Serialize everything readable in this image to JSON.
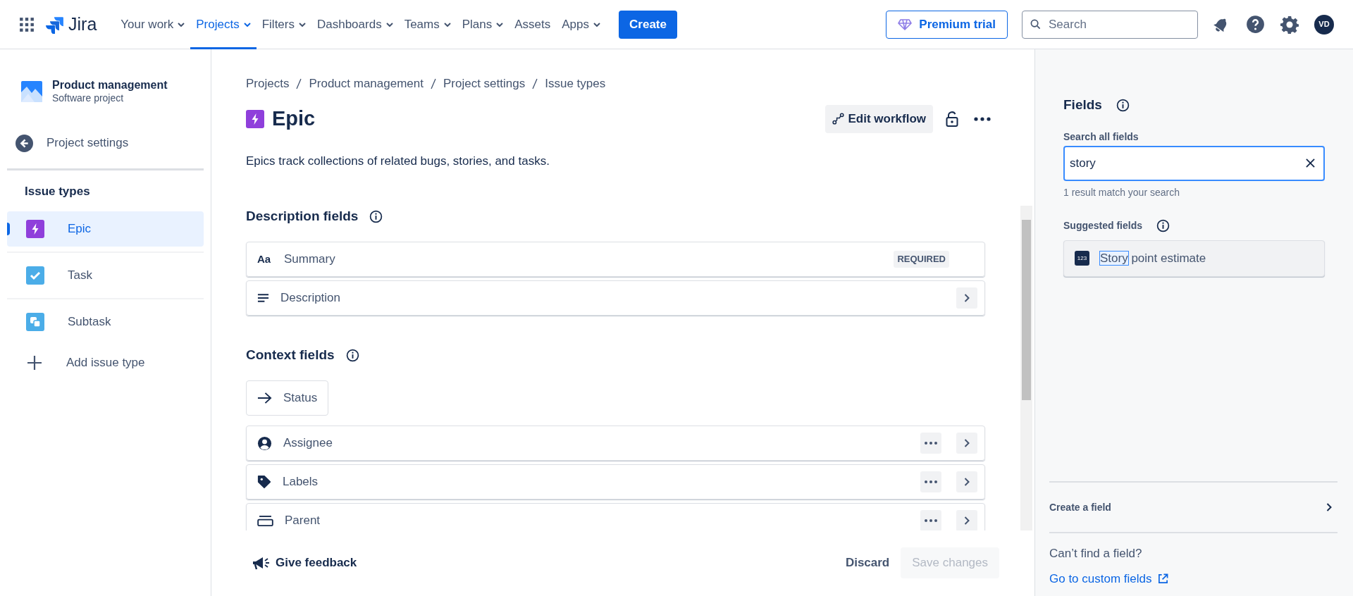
{
  "nav": {
    "logo": "Jira",
    "items": [
      {
        "label": "Your work",
        "dropdown": true,
        "selected": false
      },
      {
        "label": "Projects",
        "dropdown": true,
        "selected": true
      },
      {
        "label": "Filters",
        "dropdown": true,
        "selected": false
      },
      {
        "label": "Dashboards",
        "dropdown": true,
        "selected": false
      },
      {
        "label": "Teams",
        "dropdown": true,
        "selected": false
      },
      {
        "label": "Plans",
        "dropdown": true,
        "selected": false
      },
      {
        "label": "Assets",
        "dropdown": false,
        "selected": false
      },
      {
        "label": "Apps",
        "dropdown": true,
        "selected": false
      }
    ],
    "create": "Create",
    "premium": "Premium trial",
    "search_placeholder": "Search",
    "avatar": "VD"
  },
  "sidebar": {
    "project": "Product management",
    "project_type": "Software project",
    "back": "Project settings",
    "section": "Issue types",
    "items": [
      {
        "label": "Epic",
        "kind": "epic",
        "selected": true
      },
      {
        "label": "Task",
        "kind": "task",
        "selected": false
      },
      {
        "label": "Subtask",
        "kind": "subtask",
        "selected": false
      }
    ],
    "add": "Add issue type"
  },
  "main": {
    "breadcrumbs": [
      "Projects",
      "Product management",
      "Project settings",
      "Issue types"
    ],
    "title": "Epic",
    "edit_workflow": "Edit workflow",
    "description": "Epics track collections of related bugs, stories, and tasks.",
    "sections": [
      {
        "title": "Description fields",
        "fields": [
          {
            "label": "Summary",
            "kind": "row",
            "icon_text": "Aa",
            "badge": "REQUIRED",
            "more": false,
            "open": false
          },
          {
            "label": "Description",
            "kind": "row",
            "more": false,
            "open": true
          }
        ]
      },
      {
        "title": "Context fields",
        "fields": [
          {
            "label": "Status",
            "kind": "pill",
            "more": false,
            "open": false
          },
          {
            "label": "Assignee",
            "kind": "row",
            "more": true,
            "open": true
          },
          {
            "label": "Labels",
            "kind": "row",
            "more": true,
            "open": true
          },
          {
            "label": "Parent",
            "kind": "row",
            "more": true,
            "open": true
          }
        ]
      }
    ],
    "feedback": "Give feedback",
    "discard": "Discard",
    "save": {
      "label": "Save changes",
      "disabled": true
    }
  },
  "panel": {
    "title": "Fields",
    "search_label": "Search all fields",
    "search_value": "story",
    "result": "1 result match your search",
    "suggested_title": "Suggested fields",
    "suggestions": [
      {
        "icon_text": "123",
        "parts": [
          {
            "text": "Story",
            "highlighted": true
          },
          {
            "text": " point estimate",
            "highlighted": false
          }
        ]
      }
    ],
    "create": "Create a field",
    "cant_find": "Can’t find a field?",
    "link": "Go to custom fields"
  }
}
